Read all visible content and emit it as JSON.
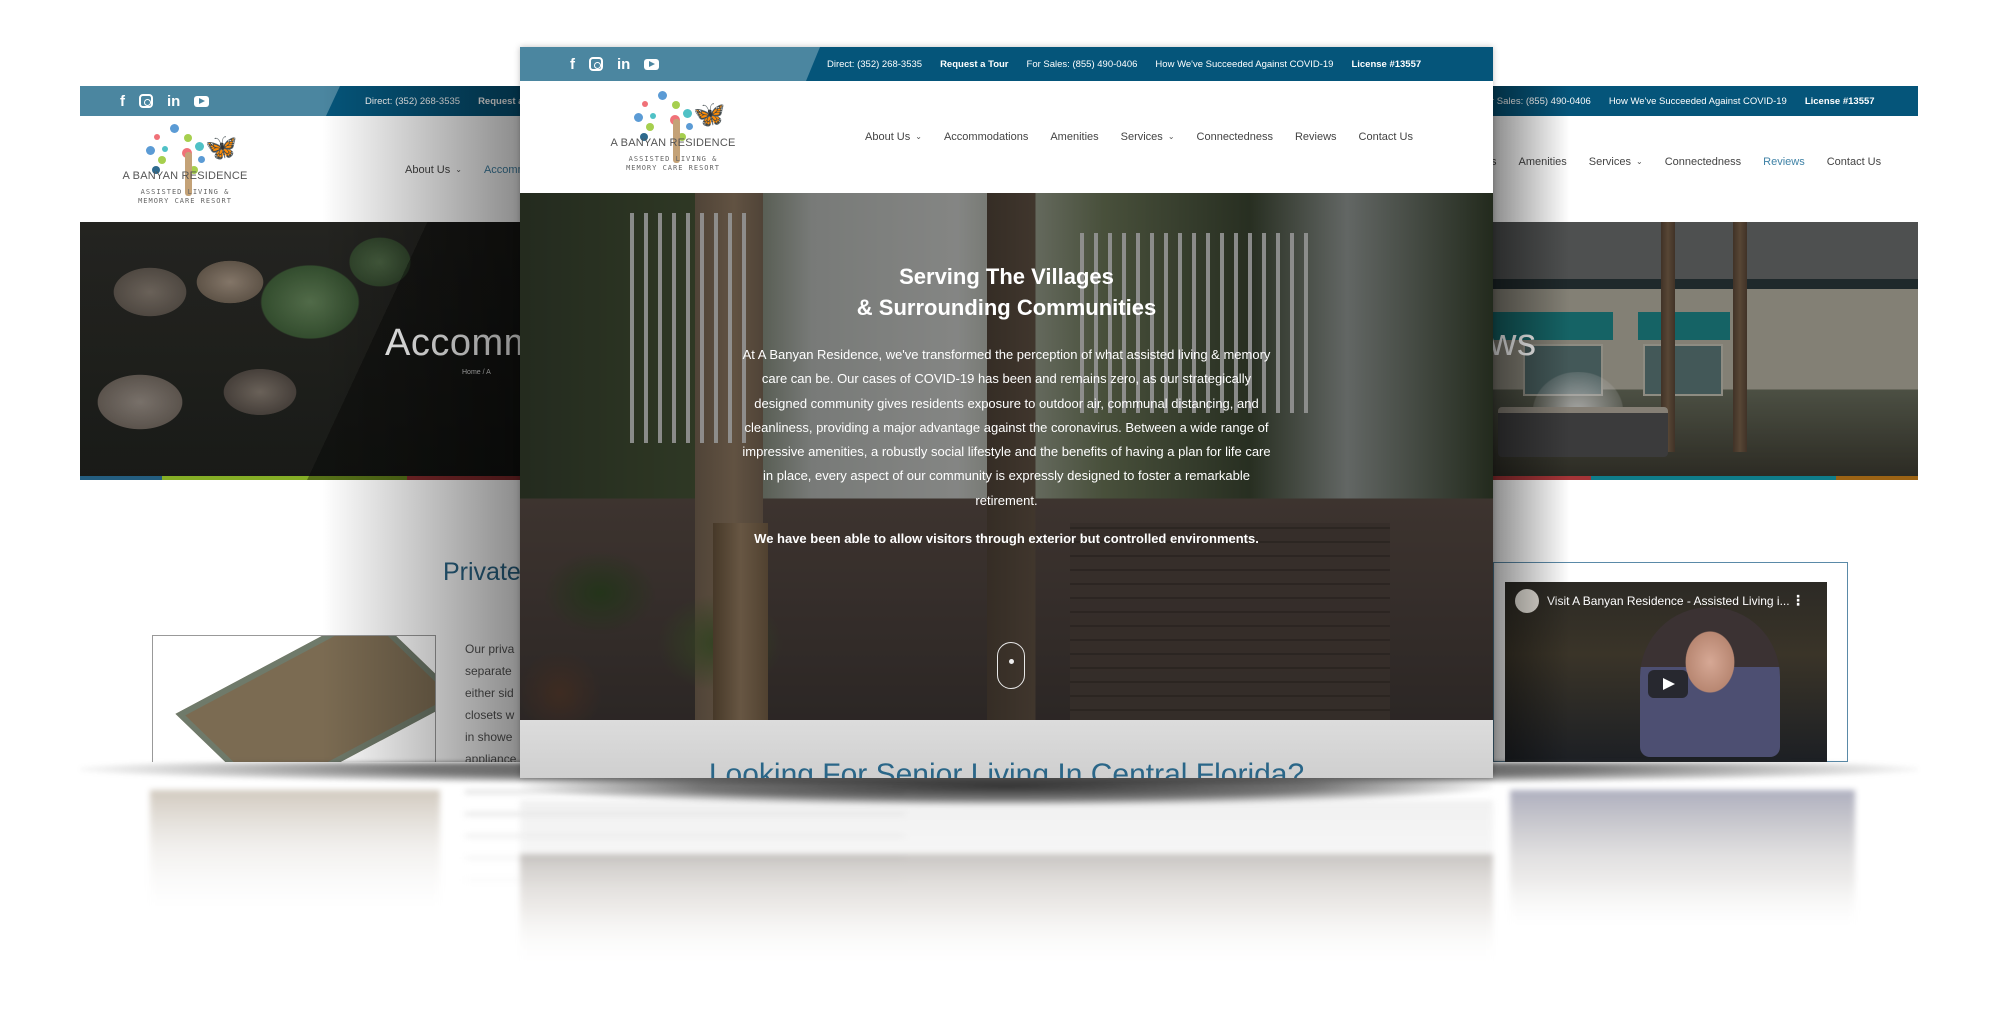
{
  "brand": {
    "name": "A BANYAN RESIDENCE",
    "tagline_1": "ASSISTED LIVING &",
    "tagline_2": "MEMORY CARE RESORT"
  },
  "colors": {
    "topbar_dark": "#05557a",
    "topbar_light": "#4b86a0",
    "accent_blue": "#2a6688",
    "active_nav": "#3f82a6",
    "stripe_left": [
      "#2a6e96",
      "#9ccc2c",
      "#e5484d"
    ],
    "stripe_right": [
      "#e5484d",
      "#15aebf",
      "#d98a1c"
    ]
  },
  "topbar": {
    "social": [
      {
        "icon": "facebook-icon",
        "glyph": "f"
      },
      {
        "icon": "instagram-icon",
        "glyph": ""
      },
      {
        "icon": "linkedin-icon",
        "glyph": "in"
      },
      {
        "icon": "youtube-icon",
        "glyph": ""
      }
    ],
    "direct": "Direct: (352) 268-3535",
    "request_tour": "Request a Tour",
    "for_sales": "For Sales: (855) 490-0406",
    "covid": "How We've Succeeded Against COVID-19",
    "license": "License #13557",
    "request_tour_truncated": "Request a To",
    "for_sales_truncated": "r Sales: (855) 490-0406"
  },
  "nav": {
    "items": [
      {
        "label": "About Us",
        "has_dropdown": true
      },
      {
        "label": "Accommodations",
        "has_dropdown": false
      },
      {
        "label": "Amenities",
        "has_dropdown": false
      },
      {
        "label": "Services",
        "has_dropdown": true
      },
      {
        "label": "Connectedness",
        "has_dropdown": false
      },
      {
        "label": "Reviews",
        "has_dropdown": false
      },
      {
        "label": "Contact Us",
        "has_dropdown": false
      }
    ],
    "left_truncated": "Accommo",
    "right_truncated": "s"
  },
  "left_page": {
    "hero_title": "Accomm",
    "breadcrumb": "Home / A",
    "section_heading": "Private",
    "body_lines": [
      "Our priva",
      "separate",
      "either sid",
      "closets w",
      "in showe",
      "appliance"
    ]
  },
  "right_page": {
    "hero_title": "ws",
    "video_title": "Visit A Banyan Residence - Assisted Living i...",
    "video_menu": "⋮"
  },
  "center_page": {
    "hero_heading_1": "Serving The Villages",
    "hero_heading_2": "& Surrounding Communities",
    "hero_paragraph": "At A Banyan Residence, we've transformed the perception of what assisted living & memory care can be. Our cases of COVID-19 has been and remains zero, as our strategically designed community gives residents exposure to outdoor air, communal distancing, and cleanliness, providing a major advantage against the coronavirus. Between a wide range of impressive amenities, a robustly social lifestyle and the benefits of having a plan for life care in place, every aspect of our community is expressly designed to foster a remarkable retirement.",
    "hero_visitors": "We have been able to allow visitors through exterior but controlled environments.",
    "section_heading": "Looking For Senior Living In Central Florida?"
  }
}
